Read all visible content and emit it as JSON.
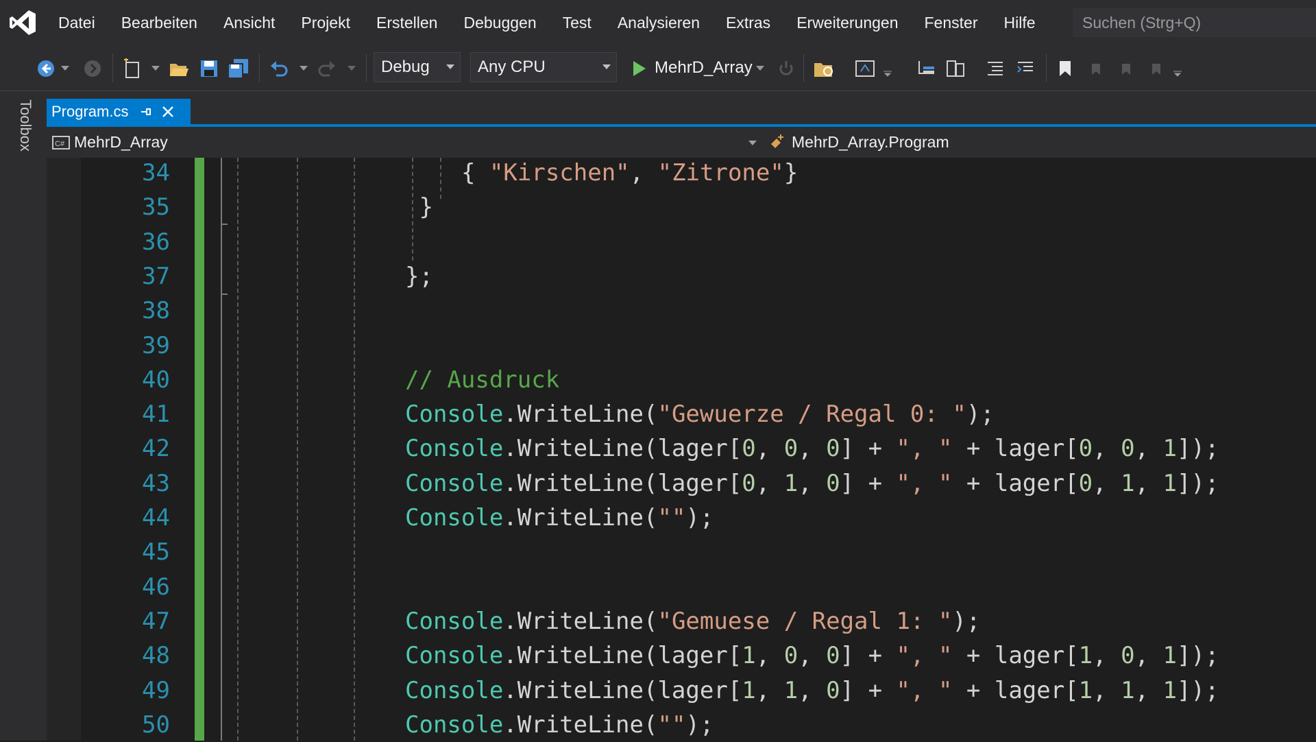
{
  "menu": {
    "items": [
      "Datei",
      "Bearbeiten",
      "Ansicht",
      "Projekt",
      "Erstellen",
      "Debuggen",
      "Test",
      "Analysieren",
      "Extras",
      "Erweiterungen",
      "Fenster",
      "Hilfe"
    ],
    "search_placeholder": "Suchen (Strg+Q)"
  },
  "toolbar": {
    "configuration": "Debug",
    "platform": "Any CPU",
    "start_target": "MehrD_Array"
  },
  "toolbox": {
    "label": "Toolbox"
  },
  "tabs": [
    {
      "title": "Program.cs",
      "active": true
    }
  ],
  "navbar": {
    "project": "MehrD_Array",
    "type": "MehrD_Array.Program"
  },
  "editor": {
    "lines": [
      {
        "num": "34",
        "tokens": [
          {
            "t": "{ ",
            "c": "t-pun"
          },
          {
            "t": "\"Kirschen\"",
            "c": "t-str"
          },
          {
            "t": ", ",
            "c": "t-pun"
          },
          {
            "t": "\"Zitrone\"",
            "c": "t-str"
          },
          {
            "t": "}",
            "c": "t-pun"
          }
        ],
        "indent": 4
      },
      {
        "num": "35",
        "tokens": [
          {
            "t": "}",
            "c": "t-pun"
          }
        ],
        "indent": 1
      },
      {
        "num": "36",
        "tokens": [],
        "indent": 0
      },
      {
        "num": "37",
        "tokens": [
          {
            "t": "};",
            "c": "t-pun"
          }
        ],
        "indent": 0
      },
      {
        "num": "38",
        "tokens": [],
        "indent": 0
      },
      {
        "num": "39",
        "tokens": [],
        "indent": 0
      },
      {
        "num": "40",
        "tokens": [
          {
            "t": "// Ausdruck",
            "c": "t-cmt"
          }
        ],
        "indent": 0
      },
      {
        "num": "41",
        "tokens": [
          {
            "t": "Console",
            "c": "t-cls"
          },
          {
            "t": ".WriteLine(",
            "c": "t-pun"
          },
          {
            "t": "\"Gewuerze / Regal 0: \"",
            "c": "t-str"
          },
          {
            "t": ");",
            "c": "t-pun"
          }
        ],
        "indent": 0
      },
      {
        "num": "42",
        "tokens": [
          {
            "t": "Console",
            "c": "t-cls"
          },
          {
            "t": ".WriteLine(lager[",
            "c": "t-pun"
          },
          {
            "t": "0",
            "c": "t-num"
          },
          {
            "t": ", ",
            "c": "t-pun"
          },
          {
            "t": "0",
            "c": "t-num"
          },
          {
            "t": ", ",
            "c": "t-pun"
          },
          {
            "t": "0",
            "c": "t-num"
          },
          {
            "t": "] + ",
            "c": "t-pun"
          },
          {
            "t": "\", \"",
            "c": "t-str"
          },
          {
            "t": " + lager[",
            "c": "t-pun"
          },
          {
            "t": "0",
            "c": "t-num"
          },
          {
            "t": ", ",
            "c": "t-pun"
          },
          {
            "t": "0",
            "c": "t-num"
          },
          {
            "t": ", ",
            "c": "t-pun"
          },
          {
            "t": "1",
            "c": "t-num"
          },
          {
            "t": "]);",
            "c": "t-pun"
          }
        ],
        "indent": 0
      },
      {
        "num": "43",
        "tokens": [
          {
            "t": "Console",
            "c": "t-cls"
          },
          {
            "t": ".WriteLine(lager[",
            "c": "t-pun"
          },
          {
            "t": "0",
            "c": "t-num"
          },
          {
            "t": ", ",
            "c": "t-pun"
          },
          {
            "t": "1",
            "c": "t-num"
          },
          {
            "t": ", ",
            "c": "t-pun"
          },
          {
            "t": "0",
            "c": "t-num"
          },
          {
            "t": "] + ",
            "c": "t-pun"
          },
          {
            "t": "\", \"",
            "c": "t-str"
          },
          {
            "t": " + lager[",
            "c": "t-pun"
          },
          {
            "t": "0",
            "c": "t-num"
          },
          {
            "t": ", ",
            "c": "t-pun"
          },
          {
            "t": "1",
            "c": "t-num"
          },
          {
            "t": ", ",
            "c": "t-pun"
          },
          {
            "t": "1",
            "c": "t-num"
          },
          {
            "t": "]);",
            "c": "t-pun"
          }
        ],
        "indent": 0
      },
      {
        "num": "44",
        "tokens": [
          {
            "t": "Console",
            "c": "t-cls"
          },
          {
            "t": ".WriteLine(",
            "c": "t-pun"
          },
          {
            "t": "\"\"",
            "c": "t-str"
          },
          {
            "t": ");",
            "c": "t-pun"
          }
        ],
        "indent": 0
      },
      {
        "num": "45",
        "tokens": [],
        "indent": 0
      },
      {
        "num": "46",
        "tokens": [],
        "indent": 0
      },
      {
        "num": "47",
        "tokens": [
          {
            "t": "Console",
            "c": "t-cls"
          },
          {
            "t": ".WriteLine(",
            "c": "t-pun"
          },
          {
            "t": "\"Gemuese / Regal 1: \"",
            "c": "t-str"
          },
          {
            "t": ");",
            "c": "t-pun"
          }
        ],
        "indent": 0
      },
      {
        "num": "48",
        "tokens": [
          {
            "t": "Console",
            "c": "t-cls"
          },
          {
            "t": ".WriteLine(lager[",
            "c": "t-pun"
          },
          {
            "t": "1",
            "c": "t-num"
          },
          {
            "t": ", ",
            "c": "t-pun"
          },
          {
            "t": "0",
            "c": "t-num"
          },
          {
            "t": ", ",
            "c": "t-pun"
          },
          {
            "t": "0",
            "c": "t-num"
          },
          {
            "t": "] + ",
            "c": "t-pun"
          },
          {
            "t": "\", \"",
            "c": "t-str"
          },
          {
            "t": " + lager[",
            "c": "t-pun"
          },
          {
            "t": "1",
            "c": "t-num"
          },
          {
            "t": ", ",
            "c": "t-pun"
          },
          {
            "t": "0",
            "c": "t-num"
          },
          {
            "t": ", ",
            "c": "t-pun"
          },
          {
            "t": "1",
            "c": "t-num"
          },
          {
            "t": "]);",
            "c": "t-pun"
          }
        ],
        "indent": 0
      },
      {
        "num": "49",
        "tokens": [
          {
            "t": "Console",
            "c": "t-cls"
          },
          {
            "t": ".WriteLine(lager[",
            "c": "t-pun"
          },
          {
            "t": "1",
            "c": "t-num"
          },
          {
            "t": ", ",
            "c": "t-pun"
          },
          {
            "t": "1",
            "c": "t-num"
          },
          {
            "t": ", ",
            "c": "t-pun"
          },
          {
            "t": "0",
            "c": "t-num"
          },
          {
            "t": "] + ",
            "c": "t-pun"
          },
          {
            "t": "\", \"",
            "c": "t-str"
          },
          {
            "t": " + lager[",
            "c": "t-pun"
          },
          {
            "t": "1",
            "c": "t-num"
          },
          {
            "t": ", ",
            "c": "t-pun"
          },
          {
            "t": "1",
            "c": "t-num"
          },
          {
            "t": ", ",
            "c": "t-pun"
          },
          {
            "t": "1",
            "c": "t-num"
          },
          {
            "t": "]);",
            "c": "t-pun"
          }
        ],
        "indent": 0
      },
      {
        "num": "50",
        "tokens": [
          {
            "t": "Console",
            "c": "t-cls"
          },
          {
            "t": ".WriteLine(",
            "c": "t-pun"
          },
          {
            "t": "\"\"",
            "c": "t-str"
          },
          {
            "t": ");",
            "c": "t-pun"
          }
        ],
        "indent": 0
      }
    ]
  },
  "colors": {
    "accent": "#007acc",
    "class_name": "#4ec9b0",
    "string": "#d69d85",
    "comment": "#57a64a",
    "number": "#b5cea8",
    "line_number": "#2b91af"
  }
}
